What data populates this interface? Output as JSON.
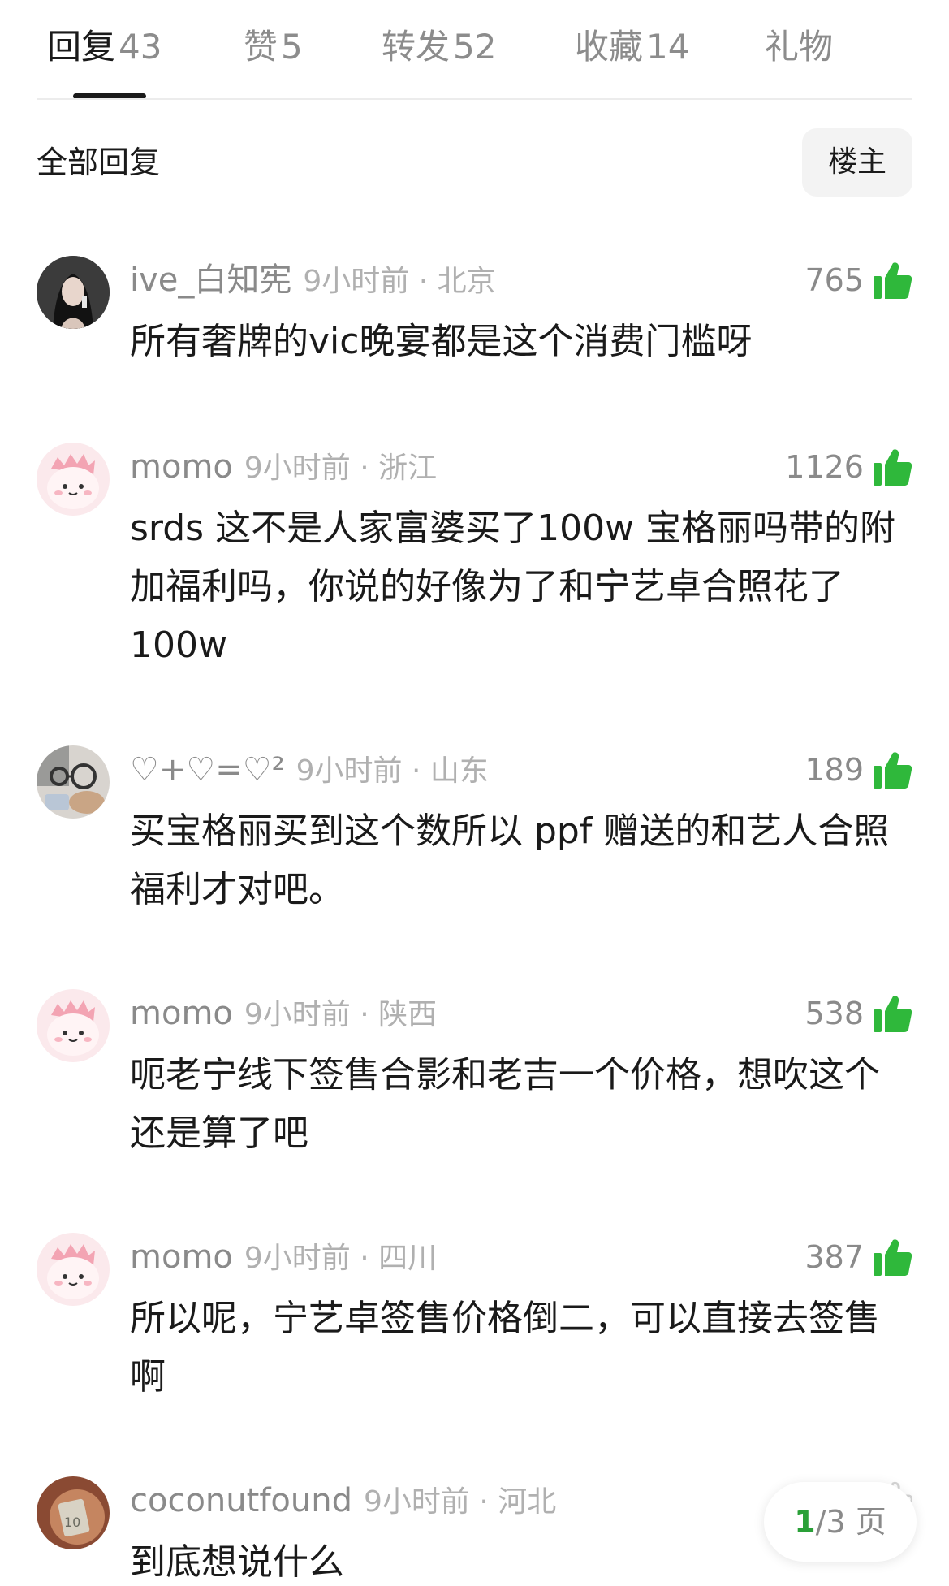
{
  "tabs": [
    {
      "label": "回复",
      "count": "43"
    },
    {
      "label": "赞",
      "count": "5"
    },
    {
      "label": "转发",
      "count": "52"
    },
    {
      "label": "收藏",
      "count": "14"
    },
    {
      "label": "礼物",
      "count": ""
    }
  ],
  "section": {
    "title": "全部回复",
    "owner_button": "楼主"
  },
  "colors": {
    "like_green": "#2fb83b",
    "pager_accent": "#2aa038"
  },
  "comments": [
    {
      "username": "ive_白知宪",
      "timeloc": "9小时前 · 北京",
      "likes": "765",
      "text": "所有奢牌的vic晚宴都是这个消费门槛呀",
      "avatar_icon": "photo-avatar-girl"
    },
    {
      "username": "momo",
      "timeloc": "9小时前 · 浙江",
      "likes": "1126",
      "text": "srds 这不是人家富婆买了100w 宝格丽吗带的附加福利吗，你说的好像为了和宁艺卓合照花了100w",
      "avatar_icon": "pink-dino-avatar"
    },
    {
      "username": "♡+♡=♡²",
      "timeloc": "9小时前 · 山东",
      "likes": "189",
      "text": "买宝格丽买到这个数所以 ppf 赠送的和艺人合照福利才对吧。",
      "avatar_icon": "photo-avatar-glasses"
    },
    {
      "username": "momo",
      "timeloc": "9小时前 · 陕西",
      "likes": "538",
      "text": "呃老宁线下签售合影和老吉一个价格，想吹这个还是算了吧",
      "avatar_icon": "pink-dino-avatar"
    },
    {
      "username": "momo",
      "timeloc": "9小时前 · 四川",
      "likes": "387",
      "text": "所以呢，宁艺卓签售价格倒二，可以直接去签售啊",
      "avatar_icon": "pink-dino-avatar"
    },
    {
      "username": "coconutfound",
      "timeloc": "9小时前 · 河北",
      "likes": "",
      "text": "到底想说什么",
      "avatar_icon": "photo-avatar-money"
    }
  ],
  "pager": {
    "current": "1",
    "total_text": "/3 页"
  }
}
